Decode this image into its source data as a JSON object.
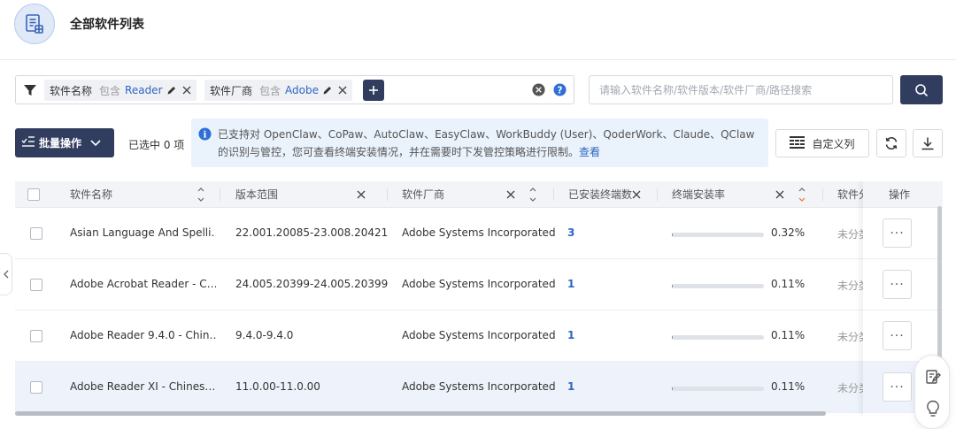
{
  "header": {
    "title": "全部软件列表",
    "logo_icon": "software-list-icon"
  },
  "filters": {
    "chips": [
      {
        "field": "软件名称",
        "operator": "包含",
        "value": "Reader"
      },
      {
        "field": "软件厂商",
        "operator": "包含",
        "value": "Adobe"
      }
    ]
  },
  "search": {
    "placeholder": "请输入软件名称/软件版本/软件厂商/路径搜索"
  },
  "toolbar": {
    "batch_label": "批量操作",
    "selected_text": "已选中 0 项",
    "custom_columns_label": "自定义列"
  },
  "notice": {
    "text": "已支持对 OpenClaw、CoPaw、AutoClaw、EasyClaw、WorkBuddy (User)、QoderWork、Claude、QClaw的识别与管控，您可查看终端安装情况，并在需要时下发管控策略进行限制。",
    "link": "查看"
  },
  "table": {
    "columns": [
      "软件名称",
      "版本范围",
      "软件厂商",
      "已安装终端数",
      "终端安装率",
      "软件分类",
      "操作"
    ],
    "rows": [
      {
        "name": "Asian Language And Spelli…",
        "version": "22.001.20085-23.008.20421",
        "vendor": "Adobe Systems Incorporated",
        "installs": "3",
        "rate": "0.32%",
        "rate_value": 0.32,
        "category": "未分类"
      },
      {
        "name": "Adobe Acrobat Reader - C…",
        "version": "24.005.20399-24.005.20399",
        "vendor": "Adobe Systems Incorporated",
        "installs": "1",
        "rate": "0.11%",
        "rate_value": 0.11,
        "category": "未分类"
      },
      {
        "name": "Adobe Reader 9.4.0 - Chin…",
        "version": "9.4.0-9.4.0",
        "vendor": "Adobe Systems Incorporated",
        "installs": "1",
        "rate": "0.11%",
        "rate_value": 0.11,
        "category": "未分类"
      },
      {
        "name": "Adobe Reader XI - Chines…",
        "version": "11.0.00-11.0.00",
        "vendor": "Adobe Systems Incorporated",
        "installs": "1",
        "rate": "0.11%",
        "rate_value": 0.11,
        "category": "未分类"
      }
    ],
    "more_label": "···"
  },
  "colors": {
    "primary": "#303d5f",
    "link": "#2d66c3",
    "notice_bg": "#eaf2fc",
    "sort_active": "#e8722c"
  }
}
